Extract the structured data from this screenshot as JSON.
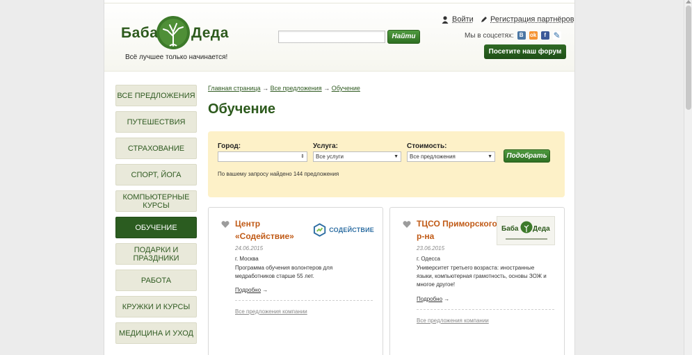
{
  "header": {
    "logo": {
      "left_word": "Баба",
      "right_word": "Деда",
      "tagline": "Всё лучшее только начинается!"
    },
    "search": {
      "value": "",
      "button_label": "Найти"
    },
    "login_label": "Войти",
    "register_label": "Регистрация партнёров",
    "social_label": "Мы в соцсетях:",
    "social_icons": [
      "vk-icon",
      "odnoklassniki-icon",
      "facebook-icon",
      "livejournal-icon"
    ],
    "forum_button_label": "Посетите наш форум"
  },
  "sidebar": {
    "items": [
      {
        "label": "Все предложения",
        "active": false
      },
      {
        "label": "Путешествия",
        "active": false
      },
      {
        "label": "Страхование",
        "active": false
      },
      {
        "label": "Спорт, йога",
        "active": false
      },
      {
        "label": "Компьютерные курсы",
        "active": false
      },
      {
        "label": "Обучение",
        "active": true
      },
      {
        "label": "Подарки и праздники",
        "active": false
      },
      {
        "label": "Работа",
        "active": false
      },
      {
        "label": "Кружки и курсы",
        "active": false
      },
      {
        "label": "Медицина и уход",
        "active": false
      }
    ]
  },
  "breadcrumb": {
    "items": [
      "Главная страница",
      "Все предложения",
      "Обучение"
    ],
    "separator": "→"
  },
  "page_title": "Обучение",
  "filter": {
    "city_label": "Город:",
    "city_value": "",
    "service_label": "Услуга:",
    "service_value": "Все услуги",
    "cost_label": "Стоимость:",
    "cost_value": "Все предложения",
    "pick_button_label": "Подобрать",
    "result_text": "По вашему запросу найдено 144 предложения"
  },
  "cards": [
    {
      "title_line1": "Центр",
      "title_line2": "«Содействие»",
      "date": "24.06.2015",
      "city": "г. Москва",
      "desc_line1": "Программа обучения волонтеров для",
      "desc_line2": "медработников старше 55 лет.",
      "desc_line3": "",
      "more_label": "Подробно",
      "more_arrow": "→",
      "all_label": "Все предложения компании",
      "company_logo_text": "СОДЕЙСТВИЕ"
    },
    {
      "title_line1": "ТЦСО Приморского",
      "title_line2": "р-на",
      "date": "23.06.2015",
      "city": "г. Одесса",
      "desc_line1": "Университет третьего возраста: иностранные",
      "desc_line2": "языки, компьютерная грамотность, основы ЗОЖ и",
      "desc_line3": "многое другое!",
      "more_label": "Подробно",
      "more_arrow": "→",
      "all_label": "Все предложения компании",
      "company_logo_left": "Баба",
      "company_logo_right": "Деда"
    }
  ],
  "colors": {
    "brand_green": "#2d5a1d",
    "active_nav": "#2b5c20",
    "nav_bg": "#e9e9da",
    "filter_bg": "#fdf1c8",
    "card_title": "#c05a16"
  }
}
